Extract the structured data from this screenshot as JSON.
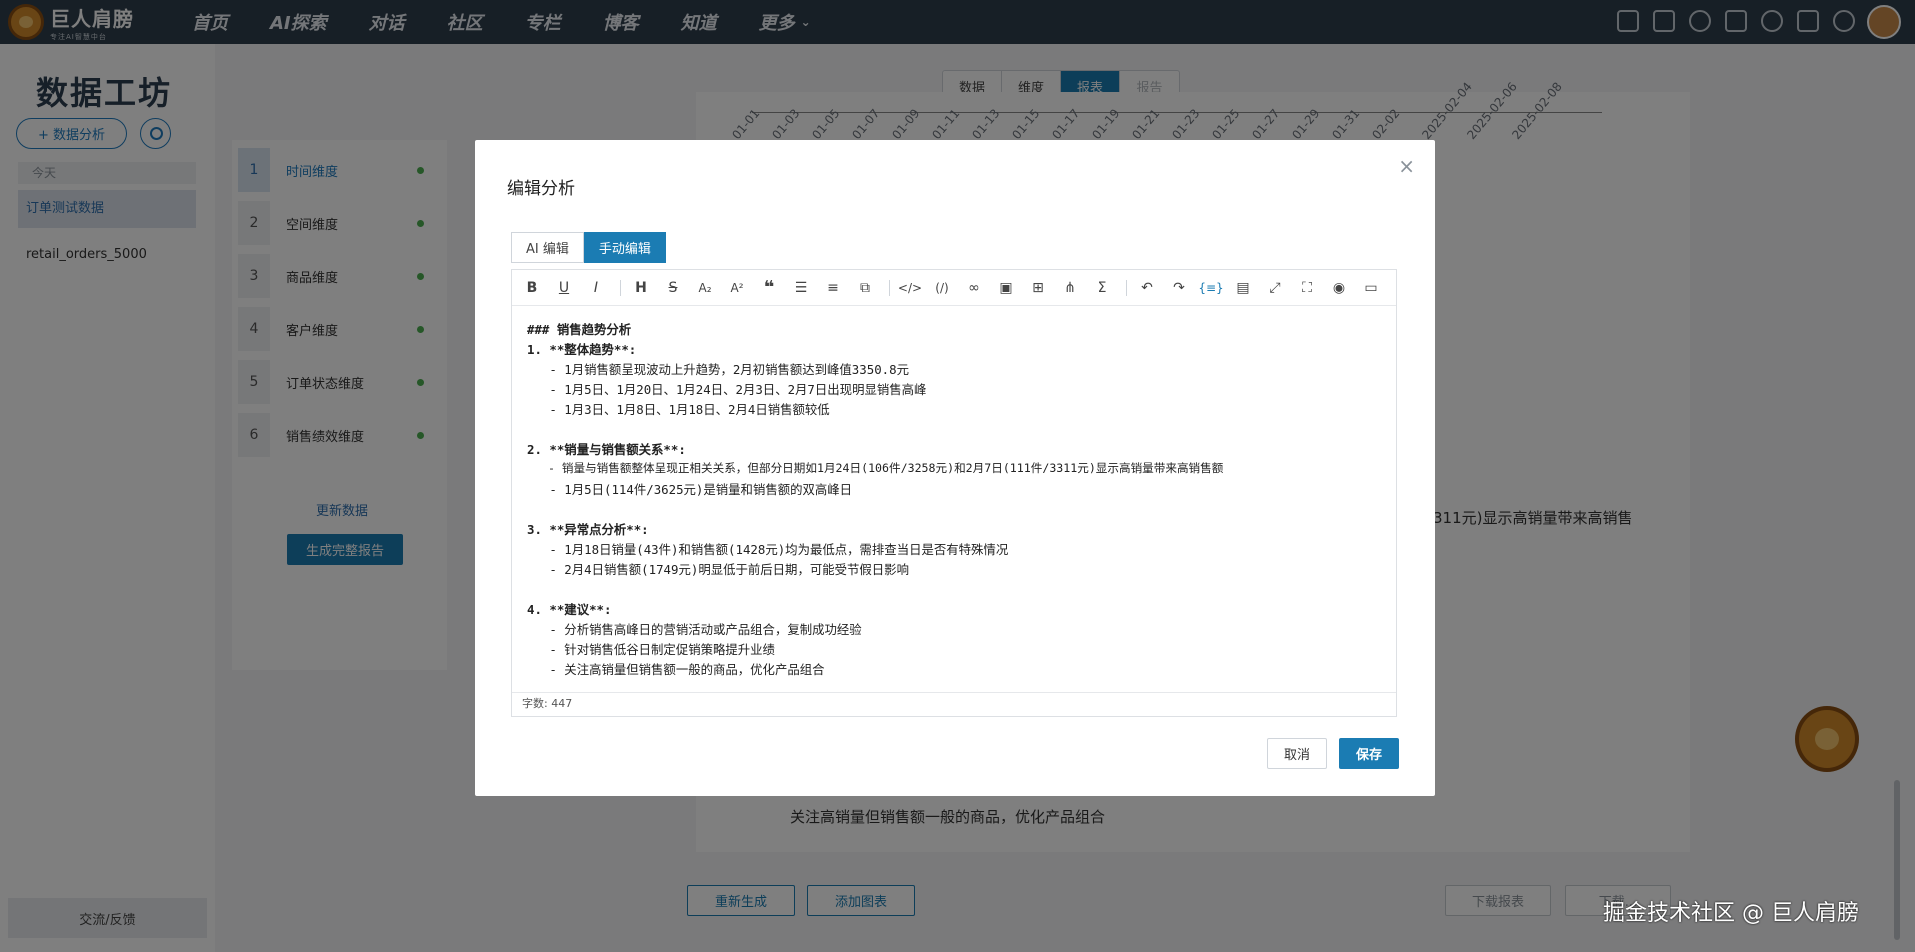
{
  "topnav": {
    "brand": "巨人肩膀",
    "brand_sub": "专注AI智慧中台",
    "links": [
      "首页",
      "AI探索",
      "对话",
      "社区",
      "专栏",
      "博客",
      "知道",
      "更多"
    ],
    "more_chevron": "⌄",
    "icons": [
      "chart-icon",
      "robot-icon",
      "magic-wand-icon",
      "notebook-icon",
      "compass-icon",
      "calendar-icon",
      "bell-icon"
    ]
  },
  "sidebar": {
    "title": "数据工坊",
    "add_button": "+ 数据分析",
    "today_label": "今天",
    "items": [
      "订单测试数据",
      "retail_orders_5000"
    ],
    "feedback": "交流/反馈"
  },
  "main": {
    "tabs": [
      "数据",
      "维度",
      "报表",
      "报告"
    ],
    "active_tab": "报表",
    "dimensions": [
      {
        "num": "1",
        "label": "时间维度"
      },
      {
        "num": "2",
        "label": "空间维度"
      },
      {
        "num": "3",
        "label": "商品维度"
      },
      {
        "num": "4",
        "label": "客户维度"
      },
      {
        "num": "5",
        "label": "订单状态维度"
      },
      {
        "num": "6",
        "label": "销售绩效维度"
      }
    ],
    "refresh_link": "更新数据",
    "generate_button": "生成完整报告",
    "date_ticks": [
      "01-01",
      "01-03",
      "01-05",
      "01-07",
      "01-09",
      "01-11",
      "01-13",
      "01-15",
      "01-17",
      "01-19",
      "01-21",
      "01-23",
      "01-25",
      "01-27",
      "01-29",
      "01-31",
      "02-02",
      "2025-02-04",
      "2025-02-06",
      "2025-02-08"
    ],
    "bg_text_1": "311元)显示高销量带来高销售",
    "bg_text_2": "关注高销量但销售额一般的商品，优化产品组合",
    "regen_button": "重新生成",
    "add_chart_button": "添加图表",
    "download_report": "下载报表",
    "download_other": "下载..."
  },
  "modal": {
    "title": "编辑分析",
    "close": "×",
    "mode_tabs": [
      "AI 编辑",
      "手动编辑"
    ],
    "active_mode": "手动编辑",
    "content_lines": [
      "### 销售趋势分析",
      "1. **整体趋势**:",
      "   - 1月销售额呈现波动上升趋势，2月初销售额达到峰值3350.8元",
      "   - 1月5日、1月20日、1月24日、2月3日、2月7日出现明显销售高峰",
      "   - 1月3日、1月8日、1月18日、2月4日销售额较低",
      "",
      "2. **销量与销售额关系**:",
      "   - 销量与销售额整体呈现正相关关系，但部分日期如1月24日(106件/3258元)和2月7日(111件/3311元)显示高销量带来高销售额",
      "   - 1月5日(114件/3625元)是销量和销售额的双高峰日",
      "",
      "3. **异常点分析**:",
      "   - 1月18日销量(43件)和销售额(1428元)均为最低点，需排查当日是否有特殊情况",
      "   - 2月4日销售额(1749元)明显低于前后日期，可能受节假日影响",
      "",
      "4. **建议**:",
      "   - 分析销售高峰日的营销活动或产品组合，复制成功经验",
      "   - 针对销售低谷日制定促销策略提升业绩",
      "   - 关注高销量但销售额一般的商品，优化产品组合"
    ],
    "word_count": "字数: 447",
    "cancel": "取消",
    "save": "保存"
  },
  "watermark": "掘金技术社区 @ 巨人肩膀"
}
